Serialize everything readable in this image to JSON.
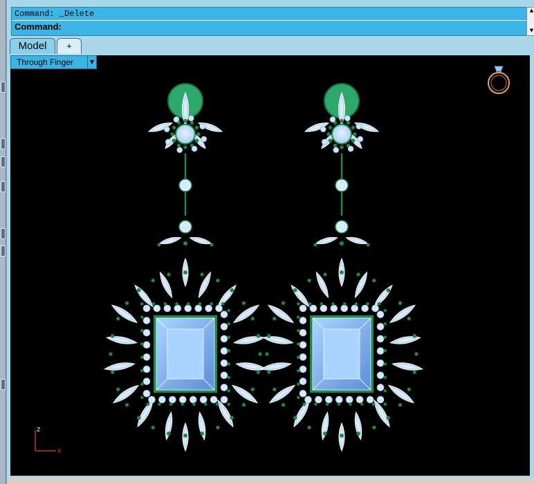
{
  "command": {
    "history_line": "Command: _Delete",
    "prompt_label": "Command:"
  },
  "tabs": [
    {
      "label": "Model"
    },
    {
      "label": "+"
    }
  ],
  "viewport": {
    "view_name": "Through Finger",
    "dropdown_glyph": "▼",
    "axis": {
      "z_label": "z",
      "x_label": "x"
    }
  },
  "icons": {
    "ring_icon": "ring-icon",
    "scroll_up": "▲",
    "scroll_down": "▼"
  },
  "colors": {
    "command_bg": "#3cb4e5",
    "frame_bg": "#a8d8ea",
    "viewport_bg": "#000000",
    "gem_main": "#8fc4f8",
    "marquise_fill": "#b6d6f2",
    "prong_green": "#1e8a4a",
    "emerald_top": "#2ea86a",
    "axis_red": "#c0392b"
  }
}
